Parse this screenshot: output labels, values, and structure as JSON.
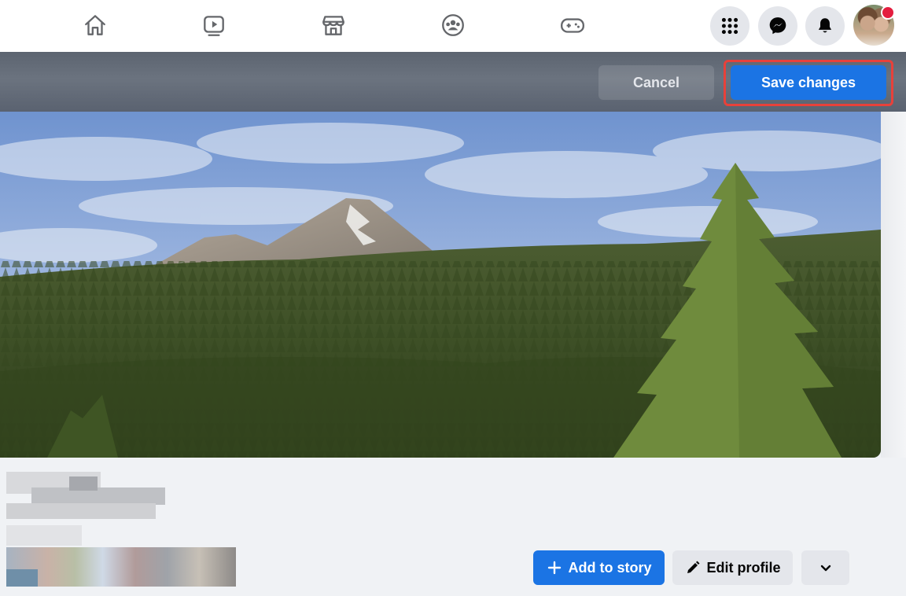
{
  "nav": {
    "tabs": [
      {
        "name": "home-icon"
      },
      {
        "name": "watch-icon"
      },
      {
        "name": "marketplace-icon"
      },
      {
        "name": "groups-icon"
      },
      {
        "name": "gaming-icon"
      }
    ],
    "right": [
      "menu-grid-icon",
      "messenger-icon",
      "bell-icon"
    ],
    "notification_color": "#e41e3f"
  },
  "cover_edit": {
    "cancel_label": "Cancel",
    "save_label": "Save changes",
    "highlight_color": "#e8413a",
    "primary_color": "#1b74e4"
  },
  "profile_actions": {
    "add_story_label": "Add to story",
    "edit_profile_label": "Edit profile",
    "add_story_icon": "plus-icon",
    "edit_profile_icon": "pencil-icon",
    "more_icon": "chevron-down-icon"
  }
}
